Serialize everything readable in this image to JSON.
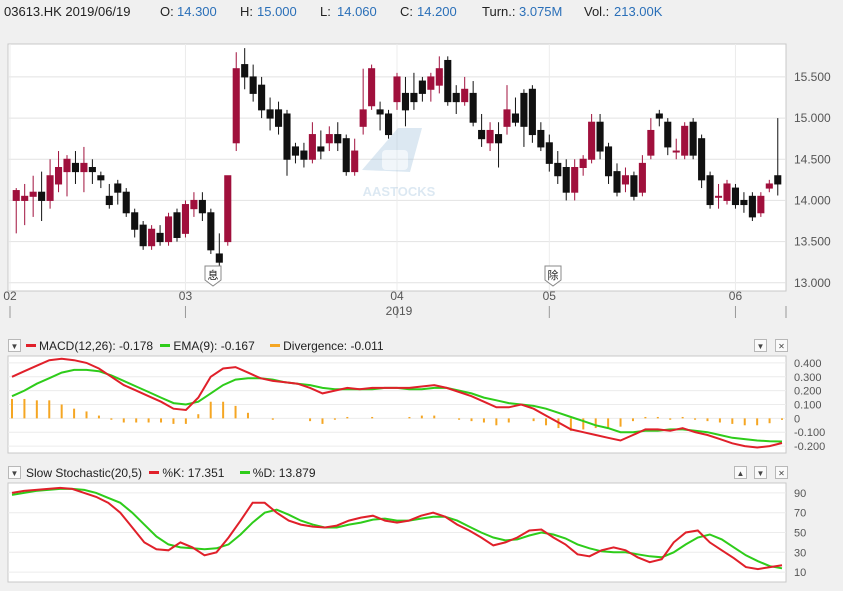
{
  "quote": {
    "symbol_date": "03613.HK 2019/06/19",
    "open_label": "O:",
    "open": "14.300",
    "high_label": "H:",
    "high": "15.000",
    "low_label": "L:",
    "low": "14.060",
    "close_label": "C:",
    "close": "14.200",
    "turnover_label": "Turn.:",
    "turnover": "3.075M",
    "volume_label": "Vol.:",
    "volume": "213.00K"
  },
  "watermark": "AASTOCKS",
  "colors": {
    "up": "#a0103c",
    "down": "#111111",
    "macd": "#e0202a",
    "ema": "#2ecc1a",
    "divergence": "#f5a623",
    "k": "#e0202a",
    "d": "#2ecc1a",
    "value_text": "#2a6fb8"
  },
  "chart_data": [
    {
      "type": "candlestick",
      "ylim": [
        12.9,
        15.9
      ],
      "y_ticks": [
        "15.500",
        "15.000",
        "14.500",
        "14.000",
        "13.500",
        "13.000"
      ],
      "month_ticks": [
        "02",
        "03",
        "04",
        "05",
        "06"
      ],
      "year_label": "2019",
      "event_markers": [
        "息",
        "除"
      ],
      "grid": true,
      "candles": [
        [
          14.0,
          14.12,
          14.15,
          13.6
        ],
        [
          14.0,
          14.05,
          14.2,
          13.7
        ],
        [
          14.05,
          14.1,
          14.3,
          13.8
        ],
        [
          14.1,
          14.0,
          14.35,
          13.75
        ],
        [
          14.0,
          14.3,
          14.5,
          13.9
        ],
        [
          14.2,
          14.4,
          14.6,
          14.1
        ],
        [
          14.35,
          14.5,
          14.55,
          14.05
        ],
        [
          14.45,
          14.35,
          14.6,
          14.2
        ],
        [
          14.35,
          14.45,
          14.65,
          14.1
        ],
        [
          14.4,
          14.35,
          14.5,
          14.2
        ],
        [
          14.3,
          14.25,
          14.35,
          14.15
        ],
        [
          14.05,
          13.95,
          14.2,
          13.9
        ],
        [
          14.2,
          14.1,
          14.25,
          13.95
        ],
        [
          14.1,
          13.85,
          14.15,
          13.8
        ],
        [
          13.85,
          13.65,
          13.9,
          13.55
        ],
        [
          13.7,
          13.45,
          13.75,
          13.4
        ],
        [
          13.45,
          13.65,
          13.7,
          13.4
        ],
        [
          13.6,
          13.5,
          13.7,
          13.45
        ],
        [
          13.5,
          13.8,
          13.85,
          13.45
        ],
        [
          13.85,
          13.55,
          13.9,
          13.5
        ],
        [
          13.6,
          13.95,
          14.0,
          13.55
        ],
        [
          13.9,
          14.0,
          14.1,
          13.8
        ],
        [
          14.0,
          13.85,
          14.1,
          13.75
        ],
        [
          13.85,
          13.4,
          13.9,
          13.35
        ],
        [
          13.35,
          13.25,
          13.6,
          13.2
        ],
        [
          13.5,
          14.3,
          14.3,
          13.45
        ],
        [
          14.7,
          15.6,
          15.8,
          14.6
        ],
        [
          15.65,
          15.5,
          15.85,
          15.35
        ],
        [
          15.5,
          15.3,
          15.65,
          15.2
        ],
        [
          15.4,
          15.1,
          15.5,
          15.0
        ],
        [
          15.1,
          15.0,
          15.25,
          14.85
        ],
        [
          15.1,
          14.9,
          15.2,
          14.8
        ],
        [
          15.05,
          14.5,
          15.1,
          14.3
        ],
        [
          14.65,
          14.55,
          14.7,
          14.45
        ],
        [
          14.6,
          14.5,
          14.7,
          14.4
        ],
        [
          14.5,
          14.8,
          14.95,
          14.45
        ],
        [
          14.65,
          14.6,
          14.85,
          14.5
        ],
        [
          14.7,
          14.8,
          14.9,
          14.6
        ],
        [
          14.8,
          14.7,
          14.95,
          14.6
        ],
        [
          14.75,
          14.35,
          14.8,
          14.3
        ],
        [
          14.35,
          14.6,
          14.75,
          14.3
        ],
        [
          14.9,
          15.1,
          15.6,
          14.8
        ],
        [
          15.15,
          15.6,
          15.65,
          15.1
        ],
        [
          15.1,
          15.05,
          15.2,
          14.85
        ],
        [
          15.05,
          14.8,
          15.1,
          14.75
        ],
        [
          15.2,
          15.5,
          15.55,
          15.1
        ],
        [
          15.3,
          15.1,
          15.5,
          14.9
        ],
        [
          15.3,
          15.2,
          15.55,
          15.1
        ],
        [
          15.45,
          15.3,
          15.5,
          15.2
        ],
        [
          15.35,
          15.5,
          15.55,
          15.2
        ],
        [
          15.4,
          15.6,
          15.75,
          15.3
        ],
        [
          15.7,
          15.2,
          15.75,
          15.15
        ],
        [
          15.3,
          15.2,
          15.4,
          15.05
        ],
        [
          15.2,
          15.35,
          15.5,
          15.15
        ],
        [
          15.3,
          14.95,
          15.45,
          14.9
        ],
        [
          14.85,
          14.75,
          15.05,
          14.65
        ],
        [
          14.7,
          14.85,
          14.95,
          14.6
        ],
        [
          14.8,
          14.7,
          14.95,
          14.4
        ],
        [
          14.9,
          15.1,
          15.4,
          14.8
        ],
        [
          15.05,
          14.95,
          15.25,
          14.9
        ],
        [
          15.3,
          14.9,
          15.35,
          14.65
        ],
        [
          15.35,
          14.8,
          15.4,
          14.7
        ],
        [
          14.85,
          14.65,
          14.95,
          14.6
        ],
        [
          14.7,
          14.45,
          14.8,
          14.35
        ],
        [
          14.45,
          14.3,
          14.6,
          14.2
        ],
        [
          14.4,
          14.1,
          14.5,
          14.0
        ],
        [
          14.1,
          14.4,
          14.5,
          14.0
        ],
        [
          14.4,
          14.5,
          14.55,
          14.3
        ],
        [
          14.5,
          14.95,
          15.05,
          14.45
        ],
        [
          14.95,
          14.6,
          15.05,
          14.5
        ],
        [
          14.65,
          14.3,
          14.7,
          14.2
        ],
        [
          14.35,
          14.1,
          14.45,
          14.05
        ],
        [
          14.2,
          14.3,
          14.4,
          14.1
        ],
        [
          14.3,
          14.05,
          14.35,
          14.0
        ],
        [
          14.1,
          14.45,
          14.55,
          14.05
        ],
        [
          14.55,
          14.85,
          15.0,
          14.5
        ],
        [
          15.05,
          15.0,
          15.1,
          14.9
        ],
        [
          14.95,
          14.65,
          15.0,
          14.55
        ],
        [
          14.6,
          14.6,
          14.75,
          14.5
        ],
        [
          14.55,
          14.9,
          14.95,
          14.5
        ],
        [
          14.95,
          14.55,
          15.0,
          14.5
        ],
        [
          14.75,
          14.25,
          14.8,
          14.15
        ],
        [
          14.3,
          13.95,
          14.35,
          13.9
        ],
        [
          14.05,
          14.05,
          14.2,
          13.9
        ],
        [
          14.0,
          14.2,
          14.25,
          13.95
        ],
        [
          14.15,
          13.95,
          14.2,
          13.9
        ],
        [
          14.0,
          13.95,
          14.1,
          13.85
        ],
        [
          14.05,
          13.8,
          14.1,
          13.75
        ],
        [
          13.85,
          14.05,
          14.1,
          13.8
        ],
        [
          14.15,
          14.2,
          14.25,
          14.1
        ],
        [
          14.3,
          14.2,
          15.0,
          14.06
        ]
      ]
    },
    {
      "type": "line",
      "title": "MACD(12,26): -0.178",
      "ylim": [
        -0.25,
        0.45
      ],
      "y_ticks": [
        "0.400",
        "0.300",
        "0.200",
        "0.100",
        "0",
        "-0.100",
        "-0.200"
      ],
      "series": [
        {
          "name": "MACD(12,26): -0.178",
          "values": [
            0.3,
            0.34,
            0.38,
            0.42,
            0.43,
            0.42,
            0.4,
            0.36,
            0.3,
            0.24,
            0.2,
            0.16,
            0.12,
            0.07,
            0.06,
            0.15,
            0.3,
            0.36,
            0.37,
            0.33,
            0.29,
            0.27,
            0.26,
            0.25,
            0.22,
            0.18,
            0.2,
            0.22,
            0.21,
            0.22,
            0.22,
            0.22,
            0.22,
            0.23,
            0.24,
            0.22,
            0.19,
            0.16,
            0.12,
            0.08,
            0.08,
            0.1,
            0.07,
            0.02,
            -0.03,
            -0.08,
            -0.1,
            -0.12,
            -0.14,
            -0.16,
            -0.12,
            -0.08,
            -0.08,
            -0.09,
            -0.07,
            -0.1,
            -0.12,
            -0.15,
            -0.18,
            -0.2,
            -0.21,
            -0.2,
            -0.178
          ]
        },
        {
          "name": "EMA(9): -0.167",
          "values": [
            0.16,
            0.2,
            0.25,
            0.29,
            0.33,
            0.35,
            0.35,
            0.34,
            0.31,
            0.27,
            0.23,
            0.19,
            0.15,
            0.11,
            0.1,
            0.12,
            0.18,
            0.24,
            0.28,
            0.29,
            0.29,
            0.28,
            0.26,
            0.25,
            0.24,
            0.22,
            0.21,
            0.21,
            0.21,
            0.21,
            0.22,
            0.22,
            0.21,
            0.21,
            0.22,
            0.22,
            0.2,
            0.18,
            0.15,
            0.13,
            0.11,
            0.1,
            0.09,
            0.07,
            0.04,
            0.01,
            -0.02,
            -0.05,
            -0.07,
            -0.1,
            -0.1,
            -0.09,
            -0.09,
            -0.08,
            -0.08,
            -0.09,
            -0.1,
            -0.12,
            -0.14,
            -0.15,
            -0.16,
            -0.165,
            -0.167
          ]
        },
        {
          "name": "Divergence: -0.011",
          "values": [
            0.14,
            0.14,
            0.13,
            0.13,
            0.1,
            0.07,
            0.05,
            0.02,
            -0.01,
            -0.03,
            -0.03,
            -0.03,
            -0.03,
            -0.04,
            -0.04,
            0.03,
            0.12,
            0.12,
            0.09,
            0.04,
            0.0,
            -0.01,
            0.0,
            0.0,
            -0.02,
            -0.04,
            -0.01,
            0.01,
            0.0,
            0.01,
            0.0,
            0.0,
            0.01,
            0.02,
            0.02,
            0.0,
            -0.01,
            -0.02,
            -0.03,
            -0.05,
            -0.03,
            0.0,
            -0.02,
            -0.05,
            -0.07,
            -0.09,
            -0.08,
            -0.07,
            -0.07,
            -0.06,
            -0.02,
            0.01,
            0.01,
            -0.01,
            0.01,
            -0.01,
            -0.02,
            -0.03,
            -0.04,
            -0.05,
            -0.05,
            -0.035,
            -0.011
          ]
        }
      ]
    },
    {
      "type": "line",
      "title": "Slow Stochastic(20,5)",
      "ylim": [
        0,
        100
      ],
      "y_ticks": [
        "90",
        "70",
        "50",
        "30",
        "10"
      ],
      "series": [
        {
          "name": "%K: 17.351",
          "values": [
            90,
            92,
            93,
            94,
            95,
            94,
            90,
            86,
            80,
            70,
            55,
            40,
            33,
            32,
            40,
            35,
            27,
            30,
            45,
            62,
            80,
            80,
            70,
            62,
            58,
            56,
            55,
            57,
            62,
            65,
            67,
            62,
            60,
            62,
            67,
            70,
            66,
            58,
            52,
            45,
            37,
            40,
            45,
            52,
            53,
            45,
            38,
            28,
            26,
            32,
            35,
            32,
            25,
            20,
            23,
            40,
            50,
            52,
            40,
            32,
            24,
            15,
            13,
            15,
            17
          ]
        },
        {
          "name": "%D: 13.879",
          "values": [
            88,
            90,
            92,
            93,
            94,
            94,
            93,
            90,
            85,
            80,
            70,
            58,
            46,
            38,
            35,
            34,
            33,
            34,
            38,
            48,
            60,
            70,
            73,
            68,
            62,
            58,
            55,
            55,
            58,
            60,
            63,
            64,
            62,
            62,
            64,
            66,
            66,
            62,
            56,
            50,
            45,
            42,
            43,
            47,
            50,
            48,
            44,
            38,
            34,
            31,
            30,
            30,
            28,
            26,
            25,
            30,
            38,
            45,
            48,
            43,
            35,
            27,
            21,
            16,
            13.879
          ]
        }
      ]
    }
  ]
}
